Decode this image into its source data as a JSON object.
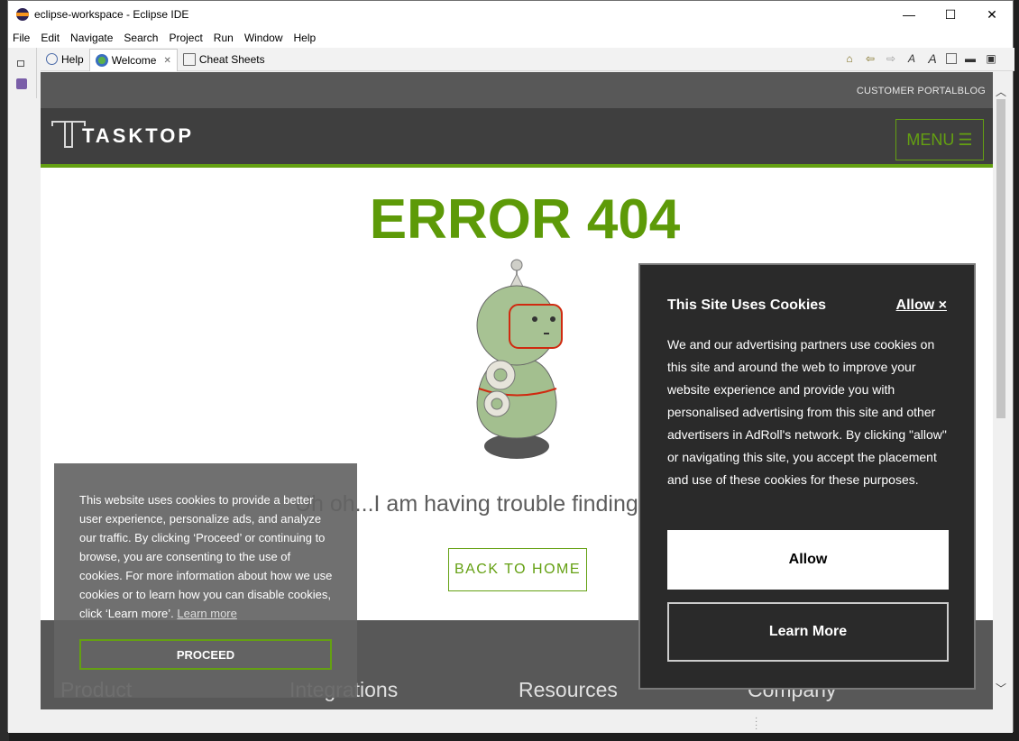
{
  "window": {
    "title": "eclipse-workspace - Eclipse IDE",
    "minimize": "—",
    "maximize": "☐",
    "close": "✕"
  },
  "menubar": [
    "File",
    "Edit",
    "Navigate",
    "Search",
    "Project",
    "Run",
    "Window",
    "Help"
  ],
  "tabs": [
    {
      "label": "Help",
      "icon": "help-icon"
    },
    {
      "label": "Welcome",
      "icon": "welcome-icon",
      "close": "✕"
    },
    {
      "label": "Cheat Sheets",
      "icon": "cheat-sheets-icon"
    }
  ],
  "page": {
    "top_links": "CUSTOMER PORTALBLOG",
    "logo_text": "TASKTOP",
    "menu_label": "MENU",
    "error_title": "ERROR 404",
    "sorry_text": "Uh oh...I am having trouble finding this page...",
    "home_button": "BACK TO HOME",
    "footer_columns": [
      "Product",
      "Integrations",
      "Resources",
      "Company"
    ]
  },
  "cookie_left": {
    "text": "This website uses cookies to provide a better user experience, personalize ads, and analyze our traffic. By clicking ‘Proceed’ or continuing to browse, you are consenting to the use of cookies. For more information about how we use cookies or to learn how you can disable cookies, click ‘Learn more’.",
    "link": "Learn more",
    "button": "PROCEED"
  },
  "cookie_right": {
    "title": "This Site Uses Cookies",
    "allow_link": "Allow ×",
    "body": "We and our advertising partners use cookies on this site and around the web to improve your website experience and provide you with personalised advertising from this site and other advertisers in AdRoll's network. By clicking \"allow\" or navigating this site, you accept the placement and use of these cookies for these purposes.",
    "allow_button": "Allow",
    "learn_button": "Learn More"
  },
  "colors": {
    "accent_green": "#64a012",
    "header_dark": "#3f3f3f"
  }
}
